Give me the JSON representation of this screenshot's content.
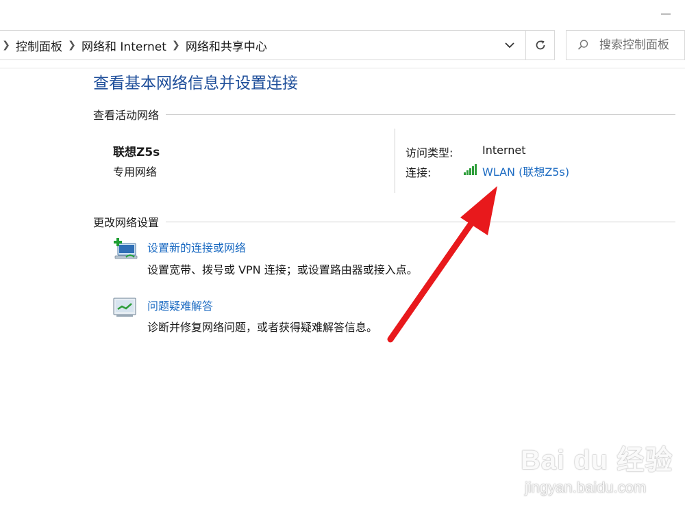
{
  "window": {
    "minimize_label": ""
  },
  "address_bar": {
    "breadcrumbs": [
      "控制面板",
      "网络和 Internet",
      "网络和共享中心"
    ],
    "search_placeholder": "搜索控制面板"
  },
  "main": {
    "title": "查看基本网络信息并设置连接",
    "active_networks": {
      "header": "查看活动网络",
      "network_name": "联想Z5s",
      "network_category": "专用网络",
      "access_type_label": "访问类型:",
      "access_type_value": "Internet",
      "connection_label": "连接:",
      "connection_value": "WLAN (联想Z5s)"
    },
    "change_settings": {
      "header": "更改网络设置",
      "tasks": [
        {
          "link": "设置新的连接或网络",
          "description": "设置宽带、拨号或 VPN 连接；或设置路由器或接入点。"
        },
        {
          "link": "问题疑难解答",
          "description": "诊断并修复网络问题，或者获得疑难解答信息。"
        }
      ]
    }
  },
  "annotation": {
    "arrow_color": "#e8191c"
  },
  "watermark": {
    "brand": "Bai du 经验",
    "domain": "jingyan.baidu.com"
  },
  "colors": {
    "title_blue": "#1e4e9a",
    "link_blue": "#1c6bc2",
    "signal_green": "#2e9e3a"
  }
}
